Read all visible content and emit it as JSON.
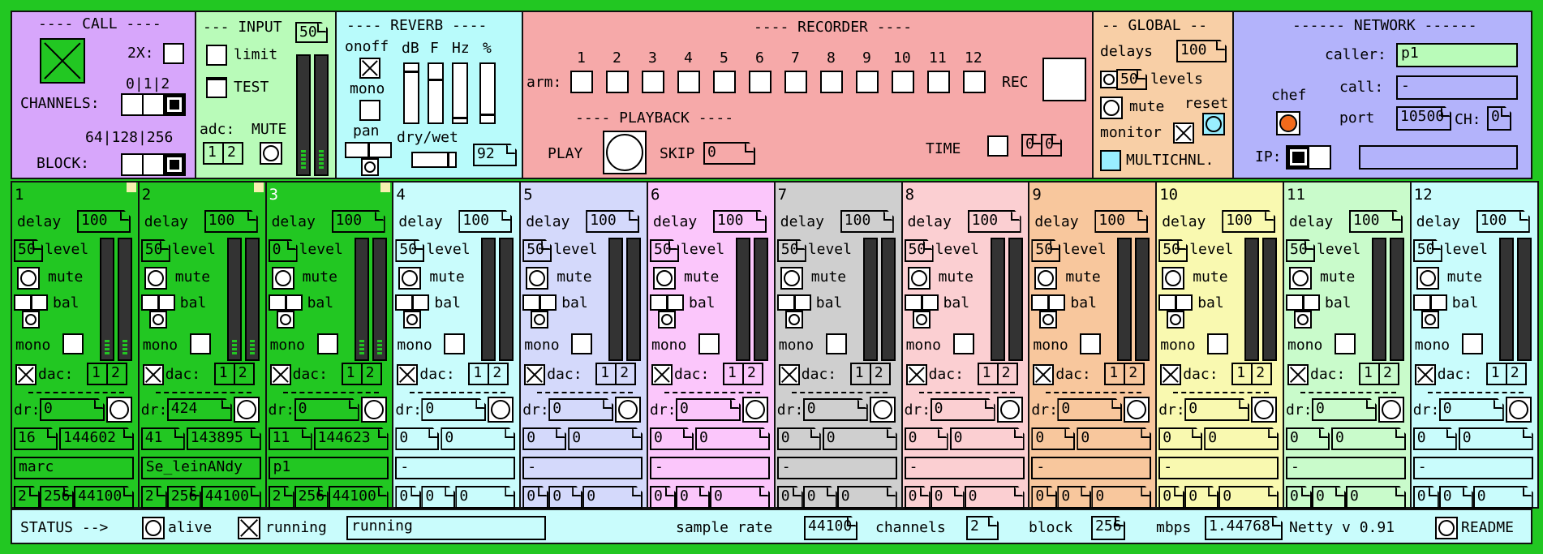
{
  "call": {
    "title": "---- CALL ----",
    "x2": "2X:",
    "ch_opts": "0|1|2",
    "channels": "CHANNELS:",
    "block_opts": "64|128|256",
    "block": "BLOCK:"
  },
  "input": {
    "title": "--- INPUT",
    "num": "50",
    "limit": "limit",
    "test": "TEST",
    "adc": "adc:",
    "mute": "MUTE",
    "adc1": "1",
    "adc2": "2"
  },
  "reverb": {
    "title": "---- REVERB ----",
    "onoff": "onoff",
    "db": "dB",
    "f": "F",
    "hz": "Hz",
    "pct": "%",
    "mono": "mono",
    "pan": "pan",
    "drywet": "dry/wet",
    "drywet_val": "92"
  },
  "recorder": {
    "title": "---- RECORDER ----",
    "arm": "arm:",
    "rec": "REC",
    "playback": "---- PLAYBACK ----",
    "play": "PLAY",
    "skip": "SKIP",
    "skip_val": "0",
    "time": "TIME",
    "t1": "0",
    "t2": "0",
    "channels": [
      "1",
      "2",
      "3",
      "4",
      "5",
      "6",
      "7",
      "8",
      "9",
      "10",
      "11",
      "12"
    ]
  },
  "global": {
    "title": "-- GLOBAL --",
    "delays": "delays",
    "delays_val": "100",
    "levels_val": "50",
    "levels": "levels",
    "mute": "mute",
    "reset": "reset",
    "monitor": "monitor",
    "multichnl": "MULTICHNL."
  },
  "network": {
    "title": "------ NETWORK ------",
    "caller": "caller:",
    "caller_val": "p1",
    "chef": "chef",
    "call": "call:",
    "call_val": "-",
    "port": "port",
    "port_val": "10500",
    "ch": "CH:",
    "ch_val": "0",
    "ip": "IP:"
  },
  "strip_labels": {
    "delay": "delay",
    "level": "level",
    "mute": "mute",
    "bal": "bal",
    "mono": "mono",
    "dac": "dac:",
    "dr": "dr:",
    "d1": "1",
    "d2": "2"
  },
  "strips": [
    {
      "num": "1",
      "delay": "100",
      "level": "50",
      "dr": "0",
      "a": "16",
      "b": "144602",
      "name": "marc",
      "c1": "2",
      "c2": "256",
      "c3": "44100",
      "bg": "#22c722",
      "active": true
    },
    {
      "num": "2",
      "delay": "100",
      "level": "50",
      "dr": "424",
      "a": "41",
      "b": "143895",
      "name": "Se_leinANdy",
      "c1": "2",
      "c2": "256",
      "c3": "44100",
      "bg": "#22c722",
      "active": true
    },
    {
      "num": "3",
      "delay": "100",
      "level": "0",
      "dr": "0",
      "a": "11",
      "b": "144623",
      "name": "p1",
      "c1": "2",
      "c2": "256",
      "c3": "44100",
      "bg": "#22c722",
      "active": true
    },
    {
      "num": "4",
      "delay": "100",
      "level": "50",
      "dr": "0",
      "a": "0",
      "b": "0",
      "name": "-",
      "c1": "0",
      "c2": "0",
      "c3": "0",
      "bg": "#c9fcfc",
      "active": false
    },
    {
      "num": "5",
      "delay": "100",
      "level": "50",
      "dr": "0",
      "a": "0",
      "b": "0",
      "name": "-",
      "c1": "0",
      "c2": "0",
      "c3": "0",
      "bg": "#d4d9fb",
      "active": false
    },
    {
      "num": "6",
      "delay": "100",
      "level": "50",
      "dr": "0",
      "a": "0",
      "b": "0",
      "name": "-",
      "c1": "0",
      "c2": "0",
      "c3": "0",
      "bg": "#fbc6fb",
      "active": false
    },
    {
      "num": "7",
      "delay": "100",
      "level": "50",
      "dr": "0",
      "a": "0",
      "b": "0",
      "name": "-",
      "c1": "0",
      "c2": "0",
      "c3": "0",
      "bg": "#cfcfcf",
      "active": false
    },
    {
      "num": "8",
      "delay": "100",
      "level": "50",
      "dr": "0",
      "a": "0",
      "b": "0",
      "name": "-",
      "c1": "0",
      "c2": "0",
      "c3": "0",
      "bg": "#fbcfd2",
      "active": false
    },
    {
      "num": "9",
      "delay": "100",
      "level": "50",
      "dr": "0",
      "a": "0",
      "b": "0",
      "name": "-",
      "c1": "0",
      "c2": "0",
      "c3": "0",
      "bg": "#f8c79d",
      "active": false
    },
    {
      "num": "10",
      "delay": "100",
      "level": "50",
      "dr": "0",
      "a": "0",
      "b": "0",
      "name": "-",
      "c1": "0",
      "c2": "0",
      "c3": "0",
      "bg": "#f9f9b0",
      "active": false
    },
    {
      "num": "11",
      "delay": "100",
      "level": "50",
      "dr": "0",
      "a": "0",
      "b": "0",
      "name": "-",
      "c1": "0",
      "c2": "0",
      "c3": "0",
      "bg": "#c9fbcb",
      "active": false
    },
    {
      "num": "12",
      "delay": "100",
      "level": "50",
      "dr": "0",
      "a": "0",
      "b": "0",
      "name": "-",
      "c1": "0",
      "c2": "0",
      "c3": "0",
      "bg": "#c9fcfc",
      "active": false
    }
  ],
  "status": {
    "label": "STATUS -->",
    "alive": "alive",
    "running": "running",
    "running_val": "running",
    "sample_rate": "sample rate",
    "sample_rate_val": "44100",
    "channels": "channels",
    "channels_val": "2",
    "block": "block",
    "block_val": "256",
    "mbps": "mbps",
    "mbps_val": "1.44768",
    "version": "Netty v 0.91",
    "readme": "README"
  },
  "colors": {
    "call": "#d7a6fb",
    "input": "#b9fbb9",
    "reverb": "#b8fbfb",
    "recorder": "#f6a9a9",
    "global": "#f8cfa6",
    "network": "#b3b3fb",
    "status": "#c9fcfc",
    "green": "#22c722"
  }
}
